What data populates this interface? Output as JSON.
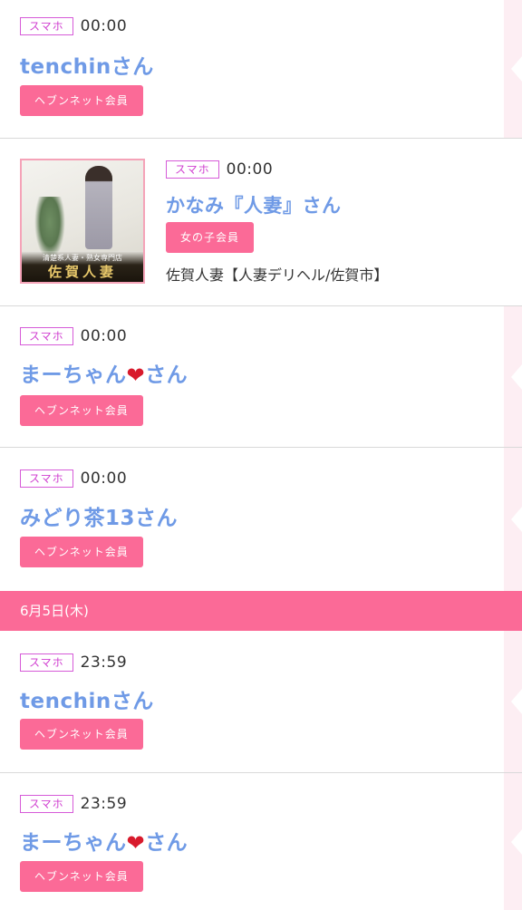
{
  "entries_before": [
    {
      "device": "スマホ",
      "time": "00:00",
      "name": "tenchinさん",
      "name_prefix": "tenchin",
      "heart": false,
      "name_suffix": "さん",
      "member": "ヘブンネット会員"
    },
    {
      "device": "スマホ",
      "time": "00:00",
      "name": "かなみ『人妻』さん",
      "heart": false,
      "member": "女の子会員",
      "shop": "佐賀人妻【人妻デリヘル/佐賀市】",
      "thumbnail": {
        "subtitle": "清楚系人妻・熟女専門店",
        "logo": "佐賀人妻"
      }
    },
    {
      "device": "スマホ",
      "time": "00:00",
      "name_prefix": "まーちゃん",
      "heart": true,
      "name_suffix": "さん",
      "member": "ヘブンネット会員"
    },
    {
      "device": "スマホ",
      "time": "00:00",
      "name": "みどり茶13さん",
      "heart": false,
      "member": "ヘブンネット会員"
    }
  ],
  "date_header": "6月5日(木)",
  "entries_after": [
    {
      "device": "スマホ",
      "time": "23:59",
      "name": "tenchinさん",
      "heart": false,
      "member": "ヘブンネット会員"
    },
    {
      "device": "スマホ",
      "time": "23:59",
      "name_prefix": "まーちゃん",
      "heart": true,
      "name_suffix": "さん",
      "member": "ヘブンネット会員"
    }
  ],
  "icons": {
    "heart": "red-heart-icon",
    "chevron": "chevron-left-icon"
  },
  "colors": {
    "accent_pink": "#fb6a97",
    "name_blue": "#6f9ae6",
    "device_magenta": "#d040d0",
    "heart_red": "#d81a2c",
    "edge_pink": "#fdeef3"
  }
}
